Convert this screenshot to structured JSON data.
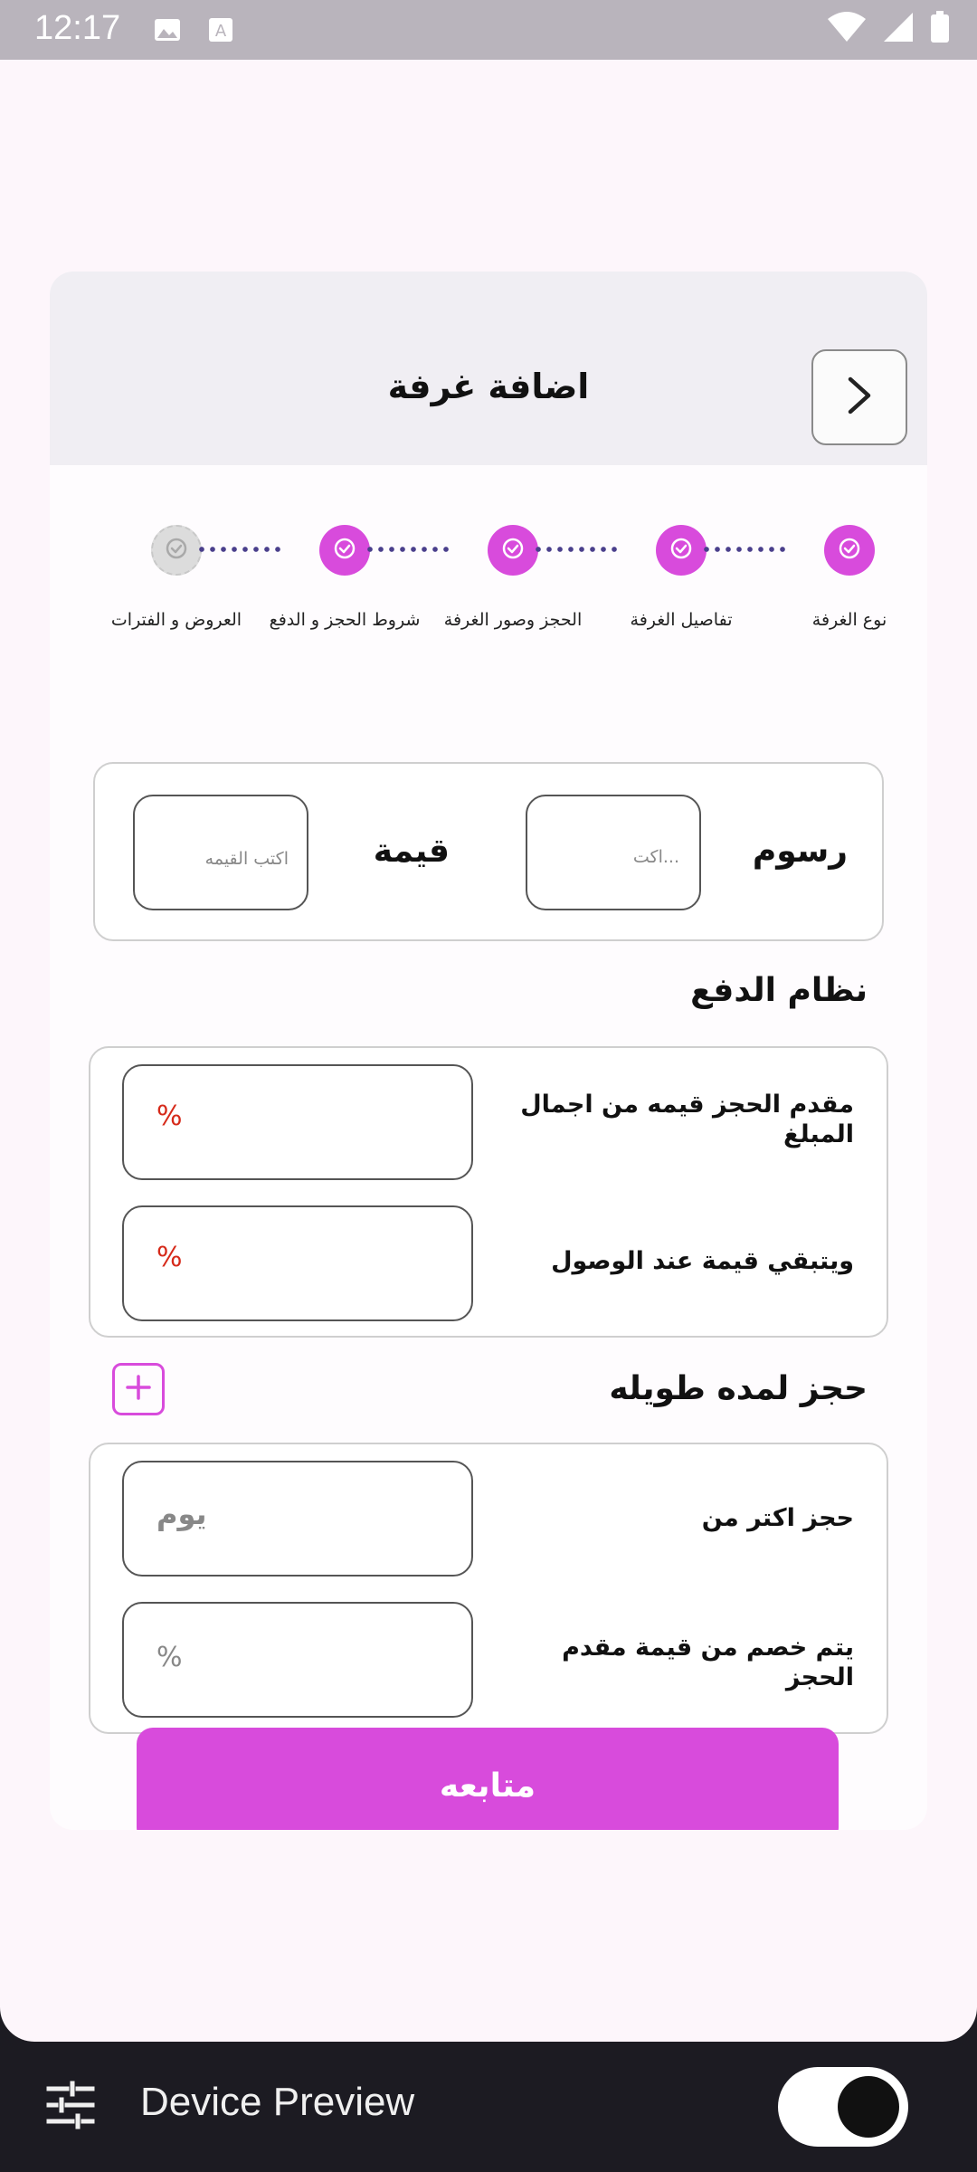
{
  "status_bar": {
    "time": "12:17"
  },
  "header": {
    "title": "اضافة غرفة"
  },
  "stepper": {
    "steps": [
      {
        "label": "نوع الغرفة",
        "state": "done"
      },
      {
        "label": "تفاصيل الغرفة",
        "state": "done"
      },
      {
        "label": "الحجز وصور الغرفة",
        "state": "done"
      },
      {
        "label": "شروط الحجز و الدفع",
        "state": "done"
      },
      {
        "label": "العروض و الفترات",
        "state": "pending"
      }
    ]
  },
  "fees": {
    "fees_label": "رسوم",
    "fees_placeholder": "اكت...",
    "value_label": "قيمة",
    "value_placeholder": "اكتب القيمه"
  },
  "payment": {
    "title": "نظام الدفع",
    "deposit_label": "مقدم الحجز قيمه من اجمال المبلغ",
    "deposit_placeholder": "%",
    "remaining_label": "ويتبقي قيمة عند الوصول",
    "remaining_placeholder": "%"
  },
  "long_stay": {
    "title": "حجز لمده طويله",
    "days_label": "حجز اكتر من",
    "days_placeholder": "يوم",
    "discount_label": "يتم خصم من قيمة مقدم الحجز",
    "discount_placeholder": "%"
  },
  "actions": {
    "continue_label": "متابعه"
  },
  "device_preview": {
    "title": "Device Preview"
  },
  "colors": {
    "accent": "#d84bdc",
    "placeholder_red": "#d62a1a",
    "step_pending": "#dcdcdc",
    "dots": "#4a3f8c"
  }
}
